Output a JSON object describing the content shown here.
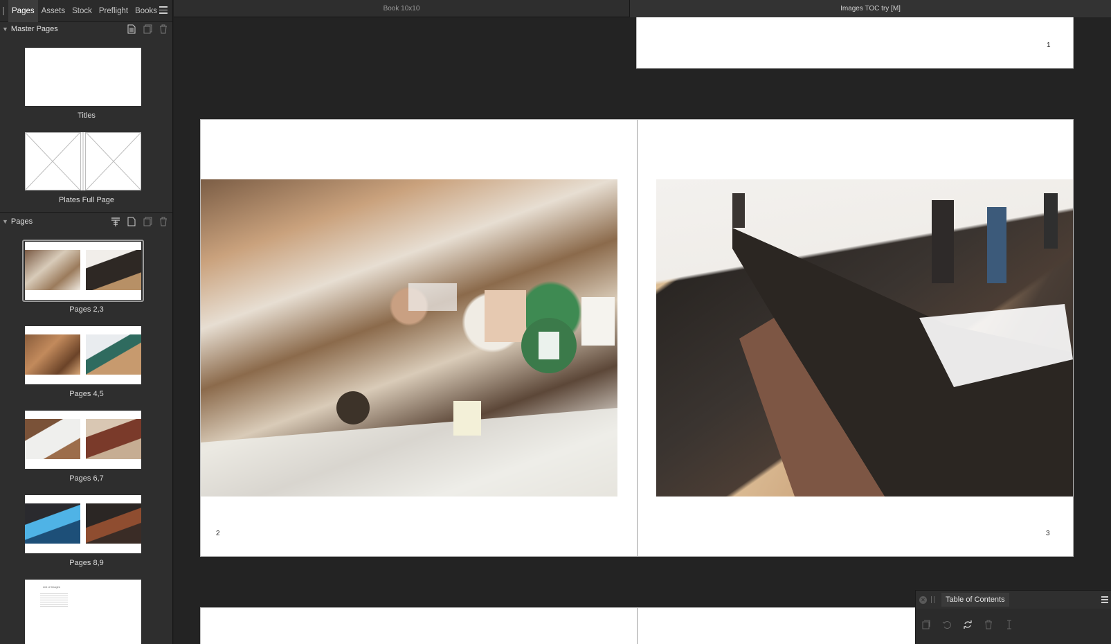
{
  "panel": {
    "tabs": [
      {
        "label": "Pages",
        "active": true
      },
      {
        "label": "Assets"
      },
      {
        "label": "Stock"
      },
      {
        "label": "Preflight"
      },
      {
        "label": "Books"
      }
    ],
    "master_pages": {
      "header": "Master Pages",
      "items": [
        {
          "label": "Titles"
        },
        {
          "label": "Plates Full Page"
        }
      ]
    },
    "pages": {
      "header": "Pages",
      "spreads": [
        {
          "label": "Pages 2,3",
          "selected": true
        },
        {
          "label": "Pages 4,5"
        },
        {
          "label": "Pages 6,7"
        },
        {
          "label": "Pages 8,9"
        }
      ],
      "last_thumb_text": "List of Images"
    }
  },
  "document": {
    "tabs": [
      {
        "label": "Book 10x10"
      },
      {
        "label": "Images TOC try [M]",
        "active": true
      }
    ],
    "page_numbers": {
      "top_right": "1",
      "left": "2",
      "right": "3"
    }
  },
  "toc": {
    "title": "Table of Contents"
  },
  "icons": [
    "hamburger-menu-icon",
    "new-page-icon",
    "duplicate-icon",
    "trash-icon",
    "chevron-down-icon",
    "close-icon",
    "refresh-icon",
    "text-flow-icon"
  ],
  "colors": {
    "panel_bg": "#2e2e2e",
    "canvas_bg": "#232323",
    "page_bg": "#ffffff",
    "selected_border": "#9c9c9c"
  }
}
